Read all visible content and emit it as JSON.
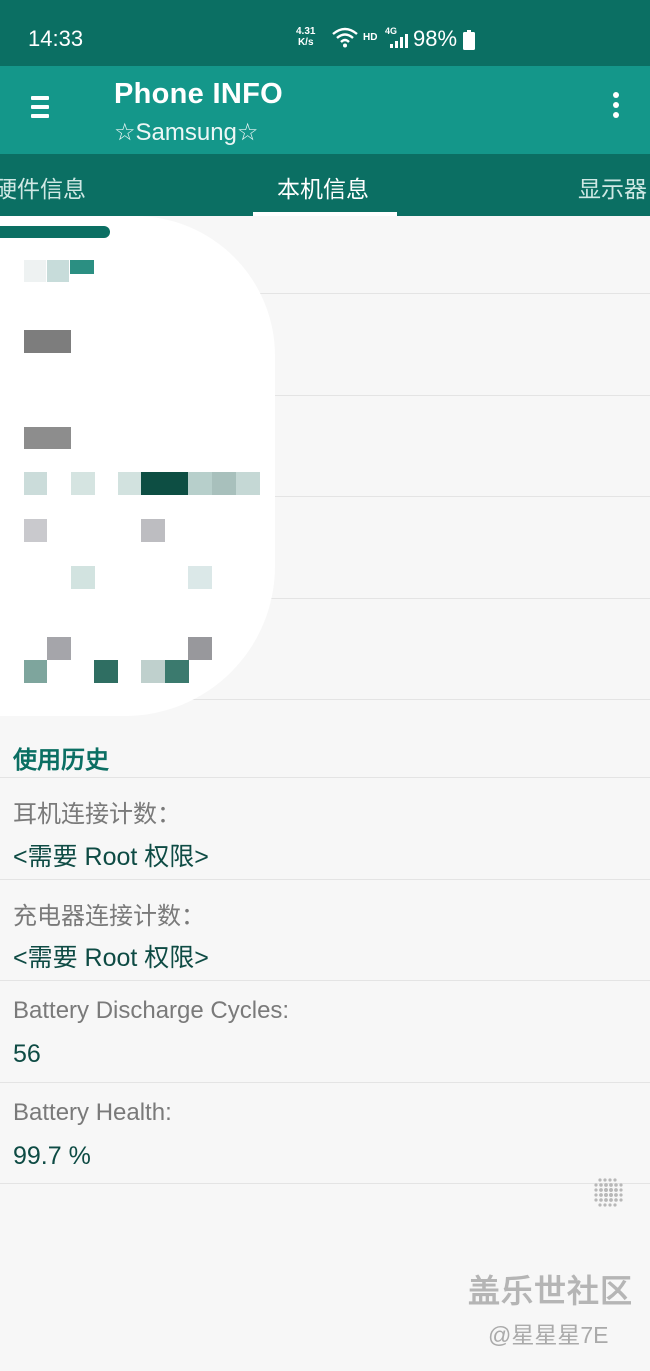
{
  "status_bar": {
    "time": "14:33",
    "net_speed_value": "4.31",
    "net_speed_unit": "K/s",
    "hd_label": "HD",
    "network_type": "4G",
    "battery_percent": "98%"
  },
  "app_bar": {
    "title": "Phone INFO",
    "subtitle": "☆Samsung☆"
  },
  "tabs": [
    {
      "label": "硬件信息"
    },
    {
      "label": "本机信息",
      "active": true
    },
    {
      "label": "显示器"
    }
  ],
  "usage_history": {
    "section_title": "使用历史",
    "items": [
      {
        "label": "耳机连接计数：",
        "value": "<需要 Root 权限>"
      },
      {
        "label": "充电器连接计数：",
        "value": "<需要 Root 权限>"
      },
      {
        "label": "Battery Discharge Cycles:",
        "value": "56"
      },
      {
        "label": "Battery Health:",
        "value": "99.7 %"
      }
    ]
  },
  "watermark": {
    "brand": "盖乐世社区",
    "user": "@星星星7E"
  },
  "colors": {
    "status_bar": "#0b6f63",
    "app_bar": "#14978a",
    "tab_bar": "#0b6f63",
    "accent_text": "#0b6f63",
    "value_text": "#0e4b44",
    "label_text": "#7a7a7a"
  }
}
